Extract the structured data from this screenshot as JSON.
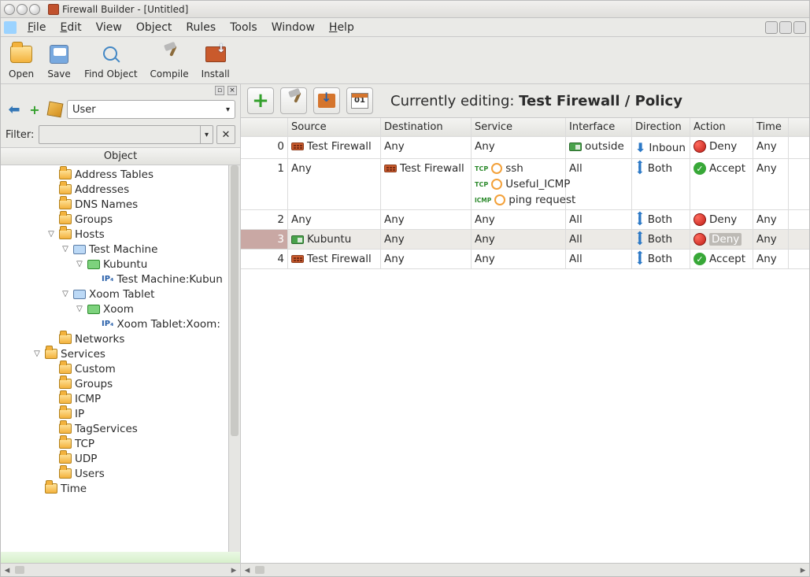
{
  "window_title": "Firewall Builder - [Untitled]",
  "menu": {
    "file": "File",
    "edit": "Edit",
    "view": "View",
    "object": "Object",
    "rules": "Rules",
    "tools": "Tools",
    "window": "Window",
    "help": "Help"
  },
  "toolbar": {
    "open": "Open",
    "save": "Save",
    "find": "Find Object",
    "compile": "Compile",
    "install": "Install"
  },
  "left": {
    "library_selected": "User",
    "filter_label": "Filter:",
    "tree_header": "Object"
  },
  "tree": [
    {
      "indent": 3,
      "exp": "",
      "icon": "folder",
      "label": "Address Tables"
    },
    {
      "indent": 3,
      "exp": "",
      "icon": "folder",
      "label": "Addresses"
    },
    {
      "indent": 3,
      "exp": "",
      "icon": "folder",
      "label": "DNS Names"
    },
    {
      "indent": 3,
      "exp": "",
      "icon": "folder",
      "label": "Groups"
    },
    {
      "indent": 3,
      "exp": "▽",
      "icon": "folder",
      "label": "Hosts"
    },
    {
      "indent": 4,
      "exp": "▽",
      "icon": "host",
      "label": "Test Machine"
    },
    {
      "indent": 5,
      "exp": "▽",
      "icon": "iface",
      "label": "Kubuntu"
    },
    {
      "indent": 6,
      "exp": "",
      "icon": "ip",
      "label": "Test Machine:Kubun"
    },
    {
      "indent": 4,
      "exp": "▽",
      "icon": "host",
      "label": "Xoom Tablet"
    },
    {
      "indent": 5,
      "exp": "▽",
      "icon": "iface",
      "label": "Xoom"
    },
    {
      "indent": 6,
      "exp": "",
      "icon": "ip",
      "label": "Xoom Tablet:Xoom:"
    },
    {
      "indent": 3,
      "exp": "",
      "icon": "folder",
      "label": "Networks"
    },
    {
      "indent": 2,
      "exp": "▽",
      "icon": "folder",
      "label": "Services"
    },
    {
      "indent": 3,
      "exp": "",
      "icon": "folder",
      "label": "Custom"
    },
    {
      "indent": 3,
      "exp": "",
      "icon": "folder",
      "label": "Groups"
    },
    {
      "indent": 3,
      "exp": "",
      "icon": "folder",
      "label": "ICMP"
    },
    {
      "indent": 3,
      "exp": "",
      "icon": "folder",
      "label": "IP"
    },
    {
      "indent": 3,
      "exp": "",
      "icon": "folder",
      "label": "TagServices"
    },
    {
      "indent": 3,
      "exp": "",
      "icon": "folder",
      "label": "TCP"
    },
    {
      "indent": 3,
      "exp": "",
      "icon": "folder",
      "label": "UDP"
    },
    {
      "indent": 3,
      "exp": "",
      "icon": "folder",
      "label": "Users"
    },
    {
      "indent": 2,
      "exp": "",
      "icon": "folder",
      "label": "Time"
    }
  ],
  "editing_prefix": "Currently editing: ",
  "editing_target": "Test Firewall / Policy",
  "cols": {
    "source": "Source",
    "destination": "Destination",
    "service": "Service",
    "interface": "Interface",
    "direction": "Direction",
    "action": "Action",
    "time": "Time"
  },
  "rules": [
    {
      "n": "0",
      "src": {
        "icon": "fw",
        "text": "Test Firewall"
      },
      "dst": {
        "text": "Any"
      },
      "svc": [
        {
          "text": "Any"
        }
      ],
      "iface": {
        "icon": "nic",
        "text": "outside"
      },
      "dir": {
        "mode": "in",
        "text": "Inboun"
      },
      "act": {
        "kind": "deny",
        "text": "Deny"
      },
      "time": "Any"
    },
    {
      "n": "1",
      "src": {
        "text": "Any"
      },
      "dst": {
        "icon": "fw",
        "text": "Test Firewall"
      },
      "svc": [
        {
          "proto": "TCP",
          "text": "ssh"
        },
        {
          "proto": "TCP",
          "text": "Useful_ICMP"
        },
        {
          "proto": "ICMP",
          "text": "ping request"
        }
      ],
      "iface": {
        "text": "All"
      },
      "dir": {
        "mode": "both",
        "text": "Both"
      },
      "act": {
        "kind": "accept",
        "text": "Accept"
      },
      "time": "Any"
    },
    {
      "n": "2",
      "src": {
        "text": "Any"
      },
      "dst": {
        "text": "Any"
      },
      "svc": [
        {
          "text": "Any"
        }
      ],
      "iface": {
        "text": "All"
      },
      "dir": {
        "mode": "both",
        "text": "Both"
      },
      "act": {
        "kind": "deny",
        "text": "Deny"
      },
      "time": "Any"
    },
    {
      "n": "3",
      "sel": true,
      "src": {
        "icon": "nic",
        "text": "Kubuntu"
      },
      "dst": {
        "text": "Any"
      },
      "svc": [
        {
          "text": "Any"
        }
      ],
      "iface": {
        "text": "All"
      },
      "dir": {
        "mode": "both",
        "text": "Both"
      },
      "act": {
        "kind": "deny",
        "text": "Deny",
        "sel": true
      },
      "time": "Any"
    },
    {
      "n": "4",
      "src": {
        "icon": "fw",
        "text": "Test Firewall"
      },
      "dst": {
        "text": "Any"
      },
      "svc": [
        {
          "text": "Any"
        }
      ],
      "iface": {
        "text": "All"
      },
      "dir": {
        "mode": "both",
        "text": "Both"
      },
      "act": {
        "kind": "accept",
        "text": "Accept"
      },
      "time": "Any"
    }
  ]
}
